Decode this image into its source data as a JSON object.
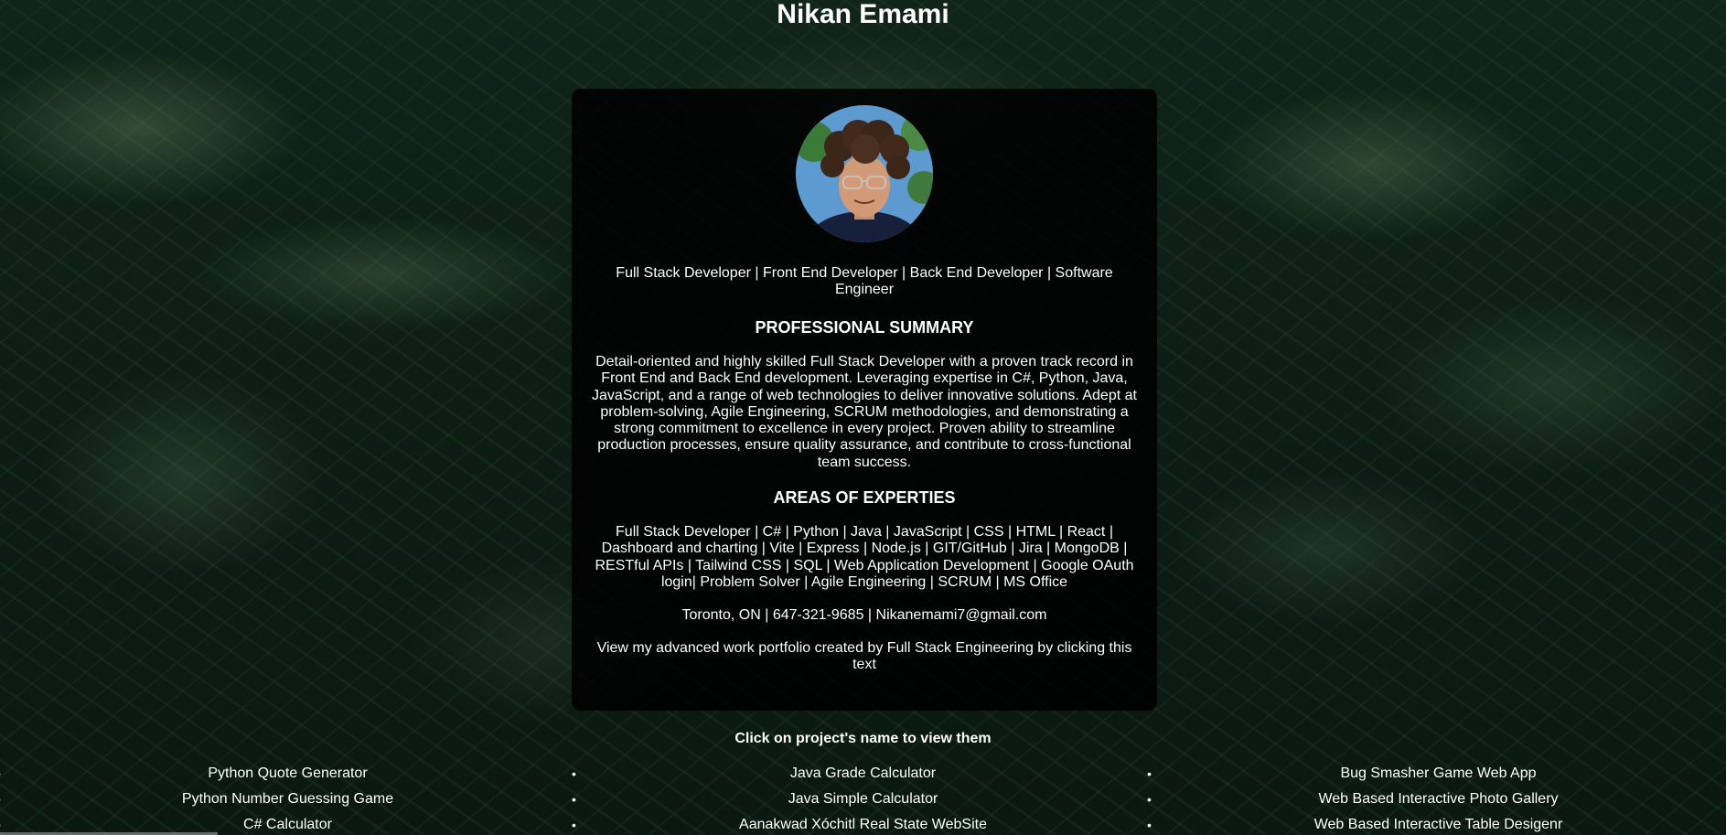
{
  "header": {
    "name": "Nikan Emami"
  },
  "profile": {
    "roles": "Full Stack Developer | Front End Developer | Back End Developer | Software Engineer",
    "summary_title": "PROFESSIONAL SUMMARY",
    "summary": "Detail-oriented and highly skilled Full Stack Developer with a proven track record in Front End and Back End development. Leveraging expertise in C#, Python, Java, JavaScript, and a range of web technologies to deliver innovative solutions. Adept at problem-solving, Agile Engineering, SCRUM methodologies, and demonstrating a strong commitment to excellence in every project. Proven ability to streamline production processes, ensure quality assurance, and contribute to cross-functional team success.",
    "expertise_title": "AREAS OF EXPERTIES",
    "expertise": "Full Stack Developer | C# | Python | Java | JavaScript | CSS | HTML | React | Dashboard and charting | Vite | Express | Node.js | GIT/GitHub | Jira | MongoDB | RESTful APIs | Tailwind CSS | SQL | Web Application Development | Google OAuth login| Problem Solver | Agile Engineering | SCRUM | MS Office",
    "contact": "Toronto, ON | 647-321-9685 | Nikanemami7@gmail.com",
    "portfolio_link": "View my advanced work portfolio created by Full Stack Engineering by clicking this text"
  },
  "projects": {
    "heading": "Click on project's name to view them",
    "columns": [
      [
        "Python Quote Generator",
        "Python Number Guessing Game",
        "C# Calculator"
      ],
      [
        "Java Grade Calculator",
        "Java Simple Calculator",
        "Aanakwad Xóchitl Real State WebSite"
      ],
      [
        "Bug Smasher Game Web App",
        "Web Based Interactive Photo Gallery",
        "Web Based Interactive Table Desigenr"
      ]
    ]
  }
}
